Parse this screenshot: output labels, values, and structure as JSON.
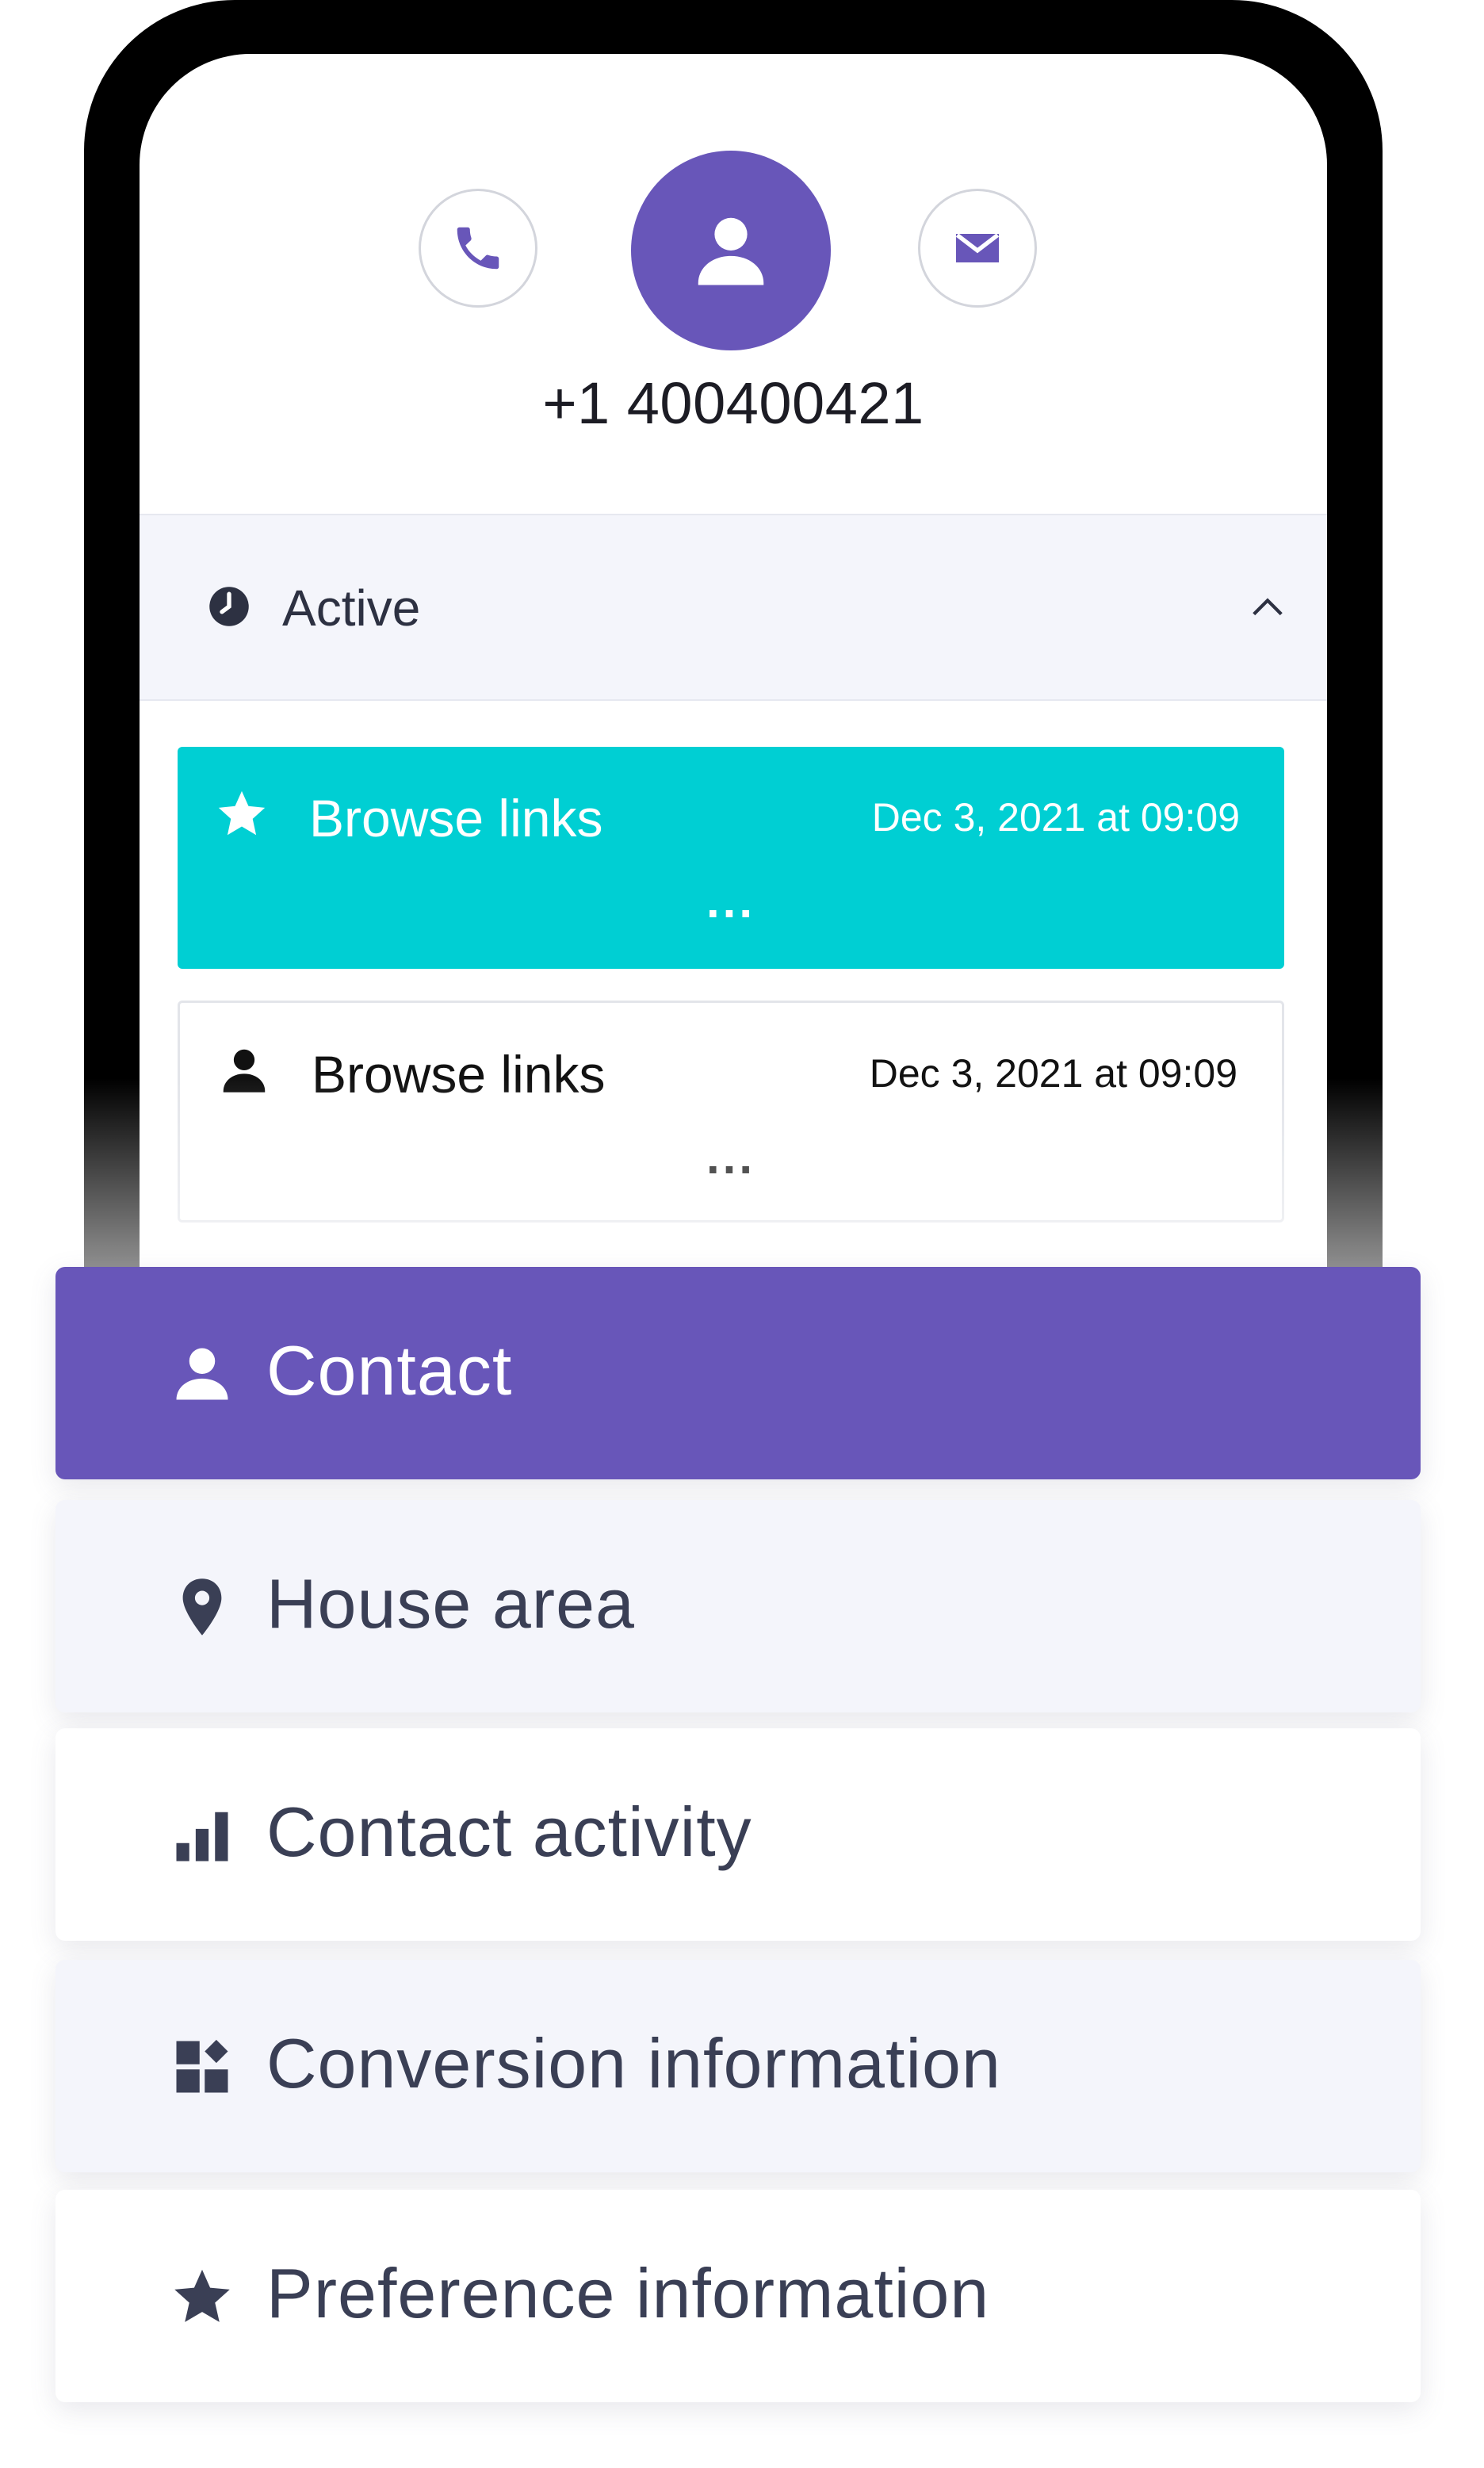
{
  "contact": {
    "phone_number": "+1 400400421",
    "actions": {
      "call_icon": "phone-icon",
      "profile_icon": "user-icon",
      "email_icon": "envelope-icon"
    }
  },
  "status": {
    "label": "Active",
    "icon": "clock-icon",
    "toggle_icon": "chevron-up-icon"
  },
  "activities": [
    {
      "title": "Browse links",
      "date": "Dec 3, 2021 at 09:09",
      "more": "...",
      "icon": "star-icon",
      "highlighted": true
    },
    {
      "title": "Browse links",
      "date": "Dec 3, 2021 at 09:09",
      "more": "...",
      "icon": "user-icon",
      "highlighted": false
    }
  ],
  "menu": [
    {
      "label": "Contact",
      "icon": "user-icon",
      "active": true
    },
    {
      "label": "House area",
      "icon": "map-pin-icon",
      "active": false
    },
    {
      "label": "Contact activity",
      "icon": "bar-chart-icon",
      "active": false
    },
    {
      "label": "Conversion information",
      "icon": "dashboard-icon",
      "active": false
    },
    {
      "label": "Preference information",
      "icon": "star-icon",
      "active": false
    }
  ],
  "colors": {
    "accent": "#6856b9",
    "highlight": "#00cfd3",
    "tint": "#f4f5fb",
    "text_dark": "#3a3f55"
  }
}
